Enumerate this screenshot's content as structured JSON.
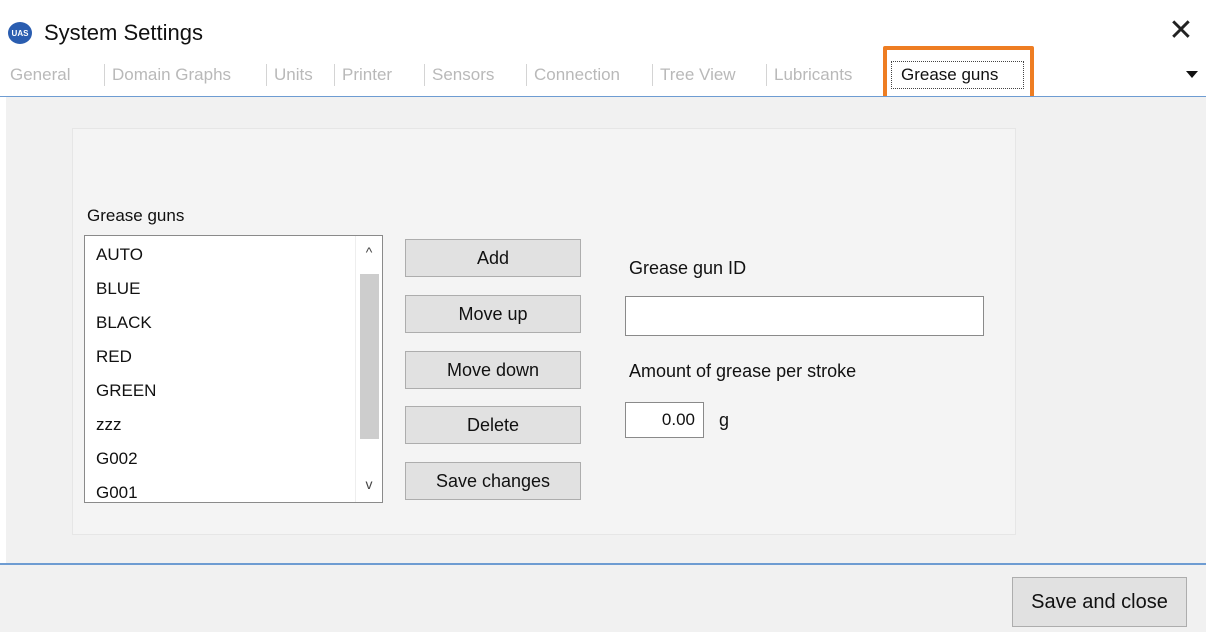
{
  "window": {
    "logo_text": "UAS",
    "title": "System Settings",
    "close_glyph": "✕"
  },
  "tabs": [
    {
      "label": "General"
    },
    {
      "label": "Domain Graphs"
    },
    {
      "label": "Units"
    },
    {
      "label": "Printer"
    },
    {
      "label": "Sensors"
    },
    {
      "label": "Connection"
    },
    {
      "label": "Tree View"
    },
    {
      "label": "Lubricants"
    },
    {
      "label": "Grease guns"
    }
  ],
  "active_tab": "Grease guns",
  "colors": {
    "highlight": "#ee7d22",
    "tab_line": "#6e9cd2"
  },
  "grease_guns": {
    "group_label": "Grease guns",
    "items": [
      "AUTO",
      "BLUE",
      "BLACK",
      "RED",
      "GREEN",
      "zzz",
      "G002",
      "G001"
    ],
    "scroll_up_glyph": "^",
    "scroll_down_glyph": "v"
  },
  "buttons": {
    "add": "Add",
    "move_up": "Move up",
    "move_down": "Move down",
    "delete": "Delete",
    "save_changes": "Save changes"
  },
  "form": {
    "id_label": "Grease gun ID",
    "id_value": "",
    "amount_label": "Amount of grease per stroke",
    "amount_value": "0.00",
    "amount_unit": "g"
  },
  "footer": {
    "save_close": "Save and close"
  }
}
